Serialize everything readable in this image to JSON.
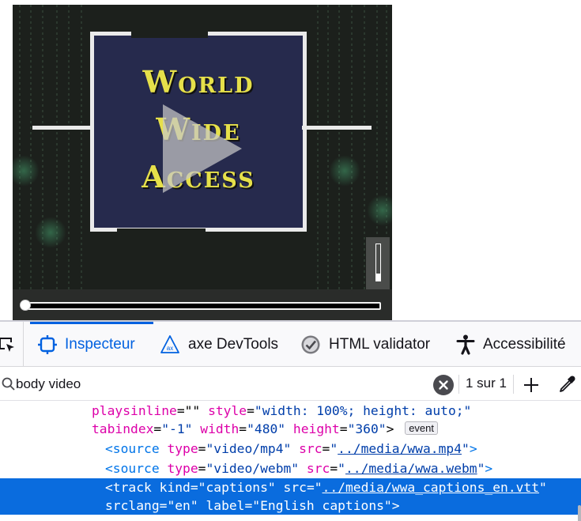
{
  "video": {
    "title_lines": [
      "World",
      "Wide",
      "Access"
    ],
    "volume_level": 0.2,
    "progress": 0.0
  },
  "devtools": {
    "tabs": [
      {
        "label": "Inspecteur",
        "icon": "inspector-icon",
        "active": true
      },
      {
        "label": "axe DevTools",
        "icon": "axe-icon",
        "active": false
      },
      {
        "label": "HTML validator",
        "icon": "check-badge-icon",
        "active": false
      },
      {
        "label": "Accessibilité",
        "icon": "accessibility-person-icon",
        "active": false
      }
    ],
    "search": {
      "value": "body video",
      "match_count": "1 sur 1"
    },
    "markup": {
      "line1": {
        "attr1_name": "playsinline",
        "attr1_eq": "=\"\"",
        "attr2_name": "style",
        "attr2_val": "\"width: 100%; height: auto;\""
      },
      "line2": {
        "attr1_name": "tabindex",
        "attr1_val": "\"-1\"",
        "attr2_name": "width",
        "attr2_val": "\"480\"",
        "attr3_name": "height",
        "attr3_val": "\"360\"",
        "close": ">",
        "badge": "event"
      },
      "line3": {
        "tag_open": "<source",
        "attr1_name": "type",
        "attr1_val": "\"video/mp4\"",
        "attr2_name": "src",
        "attr2_val_open": "\"",
        "attr2_link": "../media/wwa.mp4",
        "attr2_val_close": "\"",
        "close": ">"
      },
      "line4": {
        "tag_open": "<source",
        "attr1_name": "type",
        "attr1_val": "\"video/webm\"",
        "attr2_name": "src",
        "attr2_val_open": "\"",
        "attr2_link": "../media/wwa.webm",
        "attr2_val_close": "\"",
        "close": ">"
      },
      "line5": {
        "tag_open": "<track",
        "attr1_name": "kind",
        "attr1_val": "\"captions\"",
        "attr2_name": "src",
        "attr2_val_open": "\"",
        "attr2_link": "../media/wwa_captions_en.vtt",
        "attr2_val_close": "\""
      },
      "line6": {
        "attr1_name": "srclang",
        "attr1_val": "\"en\"",
        "attr2_name": "label",
        "attr2_val": "\"English captions\"",
        "close": ">"
      }
    }
  },
  "colors": {
    "title_yellow": "#e6e04a",
    "frame_blue": "#262a4d",
    "accent_blue": "#0061e0",
    "selection_blue": "#0a6cde",
    "tag_blue": "#0074e8",
    "attr_name_magenta": "#dd00a9",
    "attr_value_navy": "#003eaa"
  }
}
